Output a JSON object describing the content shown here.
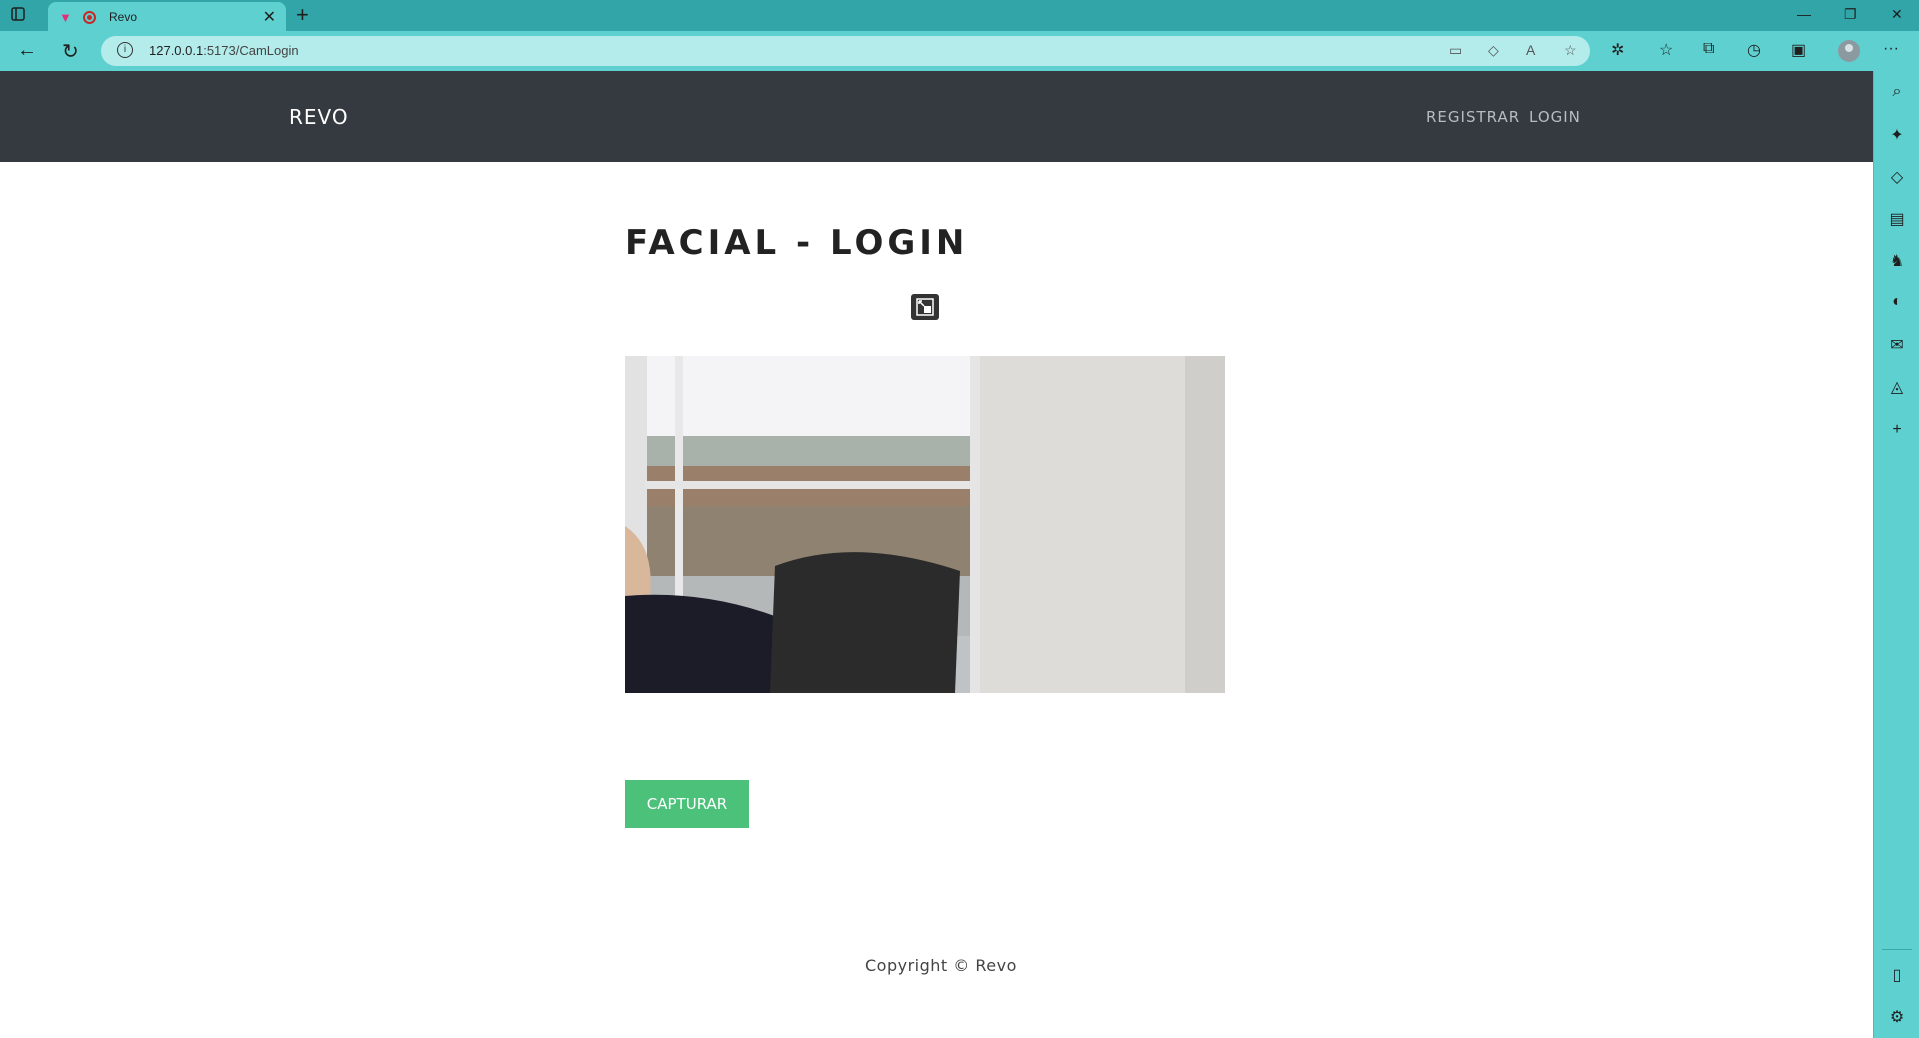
{
  "browser": {
    "tab_title": "Revo",
    "url_host": "127.0.0.1",
    "url_path": ":5173/CamLogin",
    "new_tab_glyph": "+",
    "close_glyph": "✕",
    "menu_glyph": "···",
    "icons": [
      "back-icon",
      "refresh-icon",
      "info-icon",
      "camera-icon",
      "tag-icon",
      "read-aloud-icon",
      "favorite-icon",
      "extensions-icon",
      "favorites-icon",
      "collections-icon",
      "history-icon",
      "performance-icon",
      "profile-icon",
      "more-icon"
    ]
  },
  "sidebar": {
    "icons": [
      "search-icon",
      "copilot-icon",
      "tag-icon",
      "toolbox-icon",
      "games-icon",
      "office-icon",
      "outlook-icon",
      "drop-icon",
      "add-icon",
      "split-screen-icon",
      "settings-icon"
    ]
  },
  "navbar": {
    "brand": "REVO",
    "links": [
      "REGISTRAR",
      "LOGIN"
    ]
  },
  "main": {
    "title": "FACIAL - LOGIN",
    "capture_label": "CAPTURAR"
  },
  "footer": {
    "text": "Copyright © Revo"
  },
  "colors": {
    "browser_accent": "#5fd0d0",
    "navbar": "#343a40",
    "button": "#4cc17a"
  }
}
